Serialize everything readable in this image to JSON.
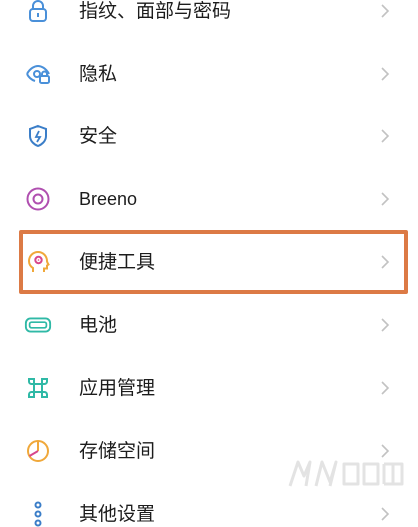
{
  "settings": {
    "items": [
      {
        "label": "指纹、面部与密码",
        "icon": "lock-icon",
        "icon_color": "#4a90d9"
      },
      {
        "label": "隐私",
        "icon": "eye-privacy-icon",
        "icon_color": "#4a90d9"
      },
      {
        "label": "安全",
        "icon": "shield-icon",
        "icon_color": "#3b7ec8"
      },
      {
        "label": "Breeno",
        "icon": "breeno-icon",
        "icon_color": "#b04fb0"
      },
      {
        "label": "便捷工具",
        "icon": "head-tools-icon",
        "icon_color": "#f0a83a"
      },
      {
        "label": "电池",
        "icon": "battery-icon",
        "icon_color": "#2fb9a6"
      },
      {
        "label": "应用管理",
        "icon": "apps-grid-icon",
        "icon_color": "#2fb9a6"
      },
      {
        "label": "存储空间",
        "icon": "storage-pie-icon",
        "icon_color": "#f0a83a"
      },
      {
        "label": "其他设置",
        "icon": "more-settings-icon",
        "icon_color": "#3b7ec8"
      }
    ],
    "chevron_icon": "chevron-right-icon",
    "highlighted_item": "便捷工具",
    "highlight_color": "#dc7a45"
  }
}
